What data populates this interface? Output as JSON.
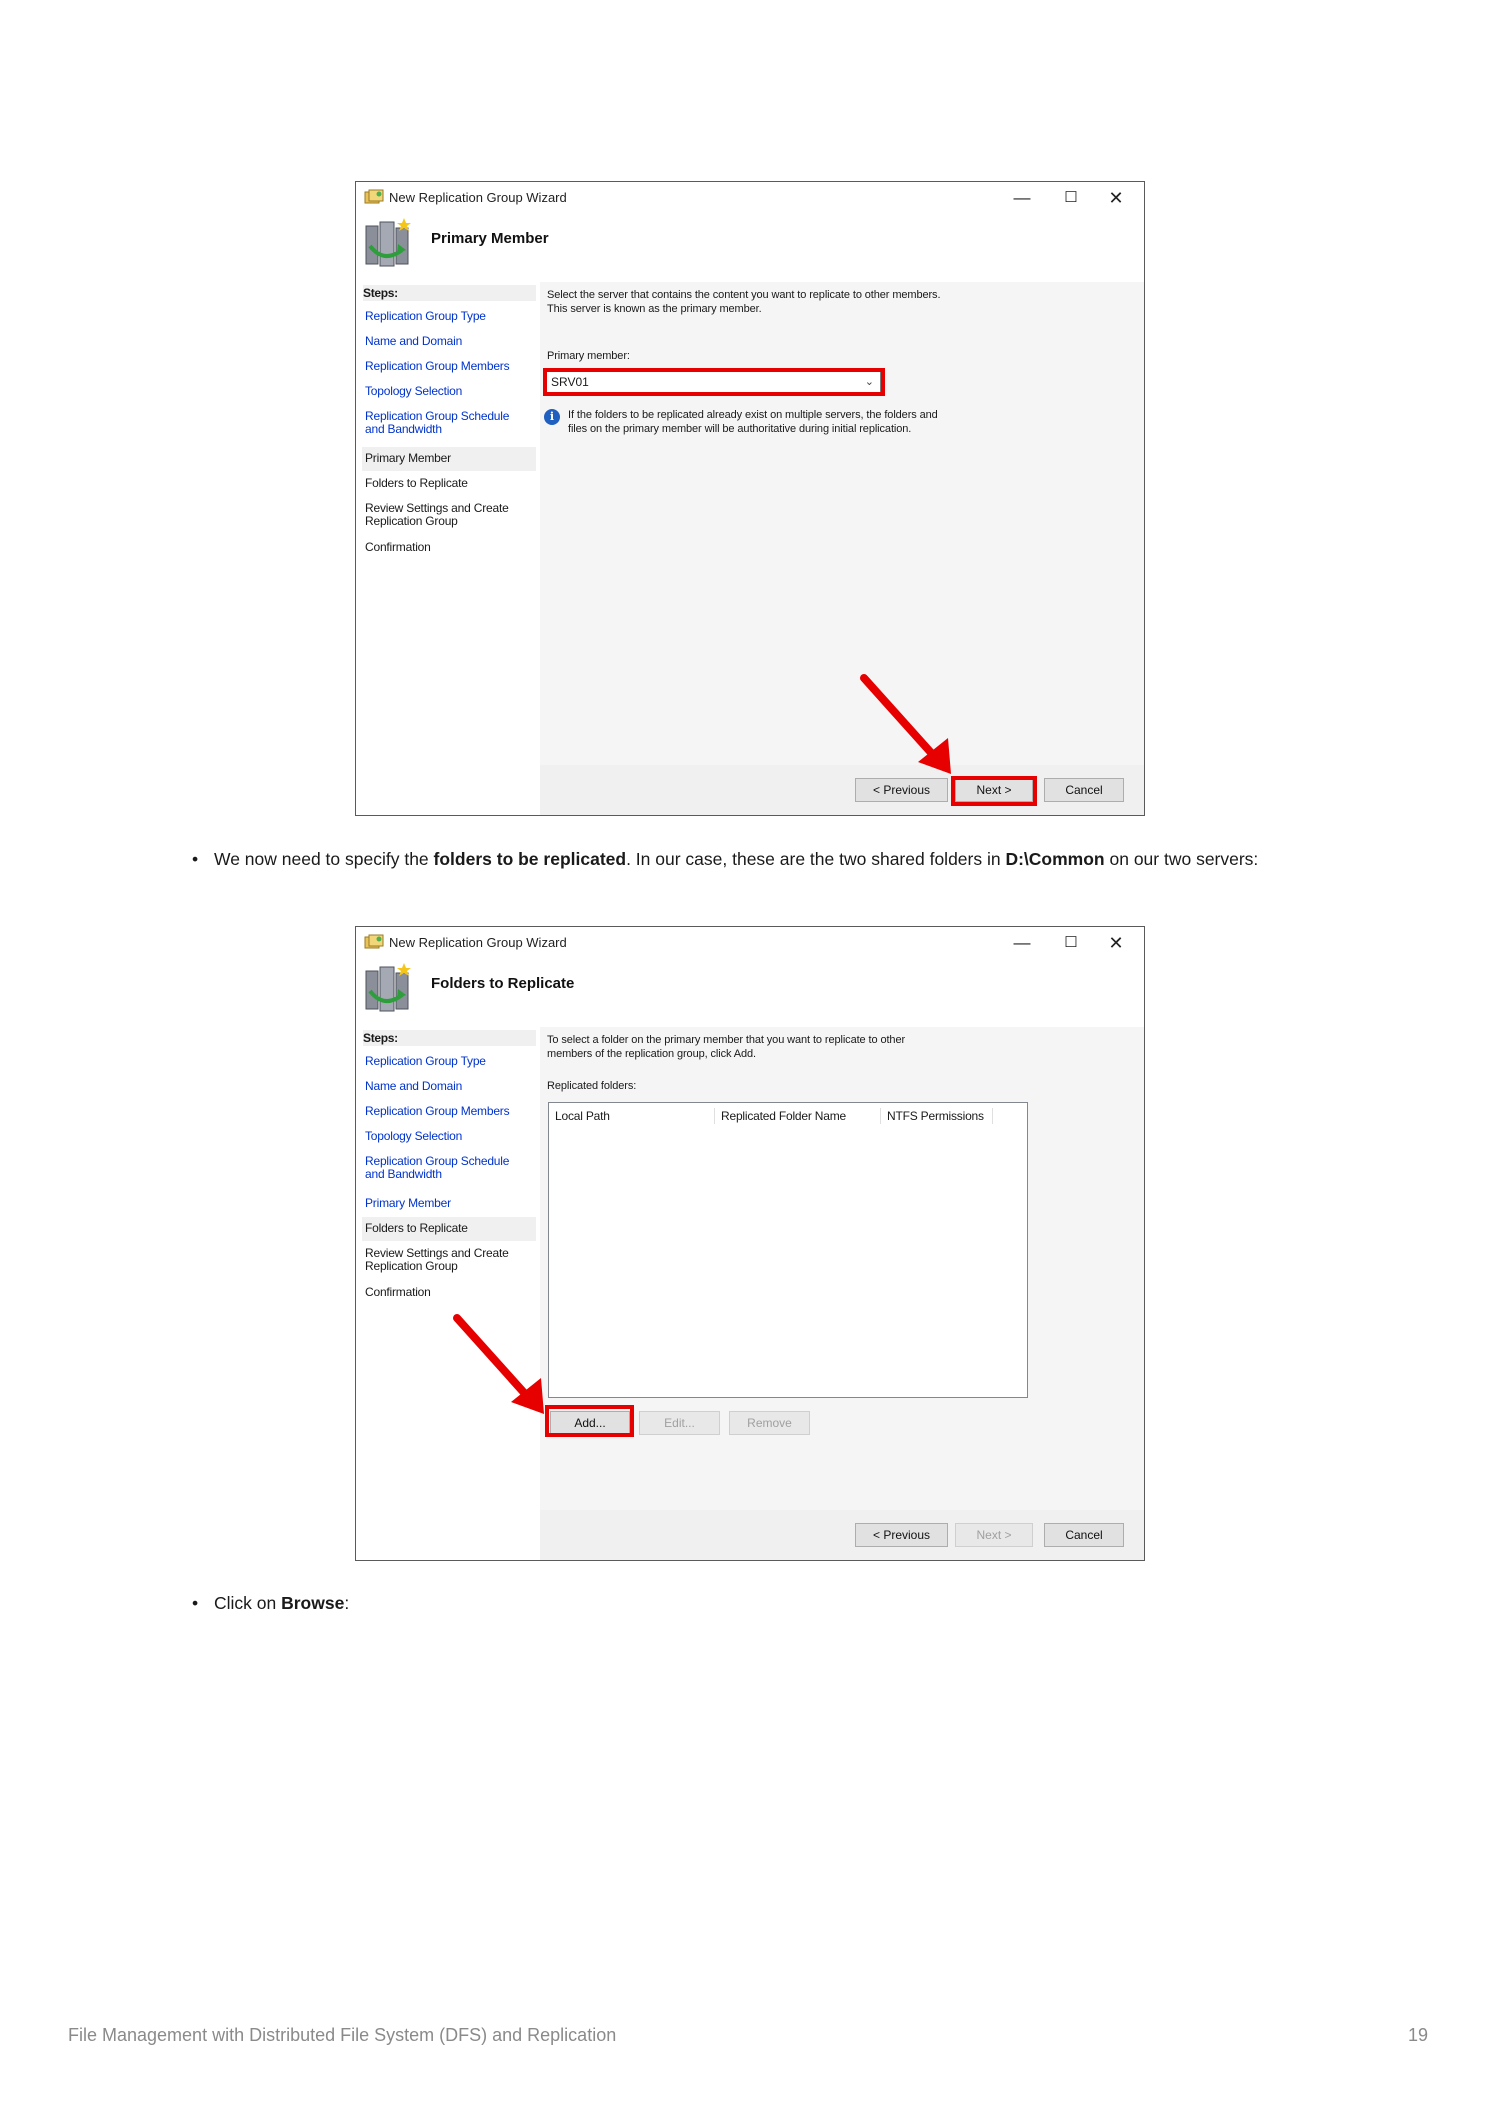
{
  "doc": {
    "bullet1_pre": "We now need to specify the ",
    "bullet1_bold1": "folders to be replicated",
    "bullet1_mid": ". In our case, these are the two shared folders in ",
    "bullet1_bold2": "D:\\Common",
    "bullet1_post": " on our two servers:",
    "bullet2_pre": "Click on ",
    "bullet2_bold": "Browse",
    "bullet2_post": ":",
    "footer_title": "File Management with Distributed File System (DFS) and Replication",
    "page_number": "19"
  },
  "wizard1": {
    "window_title": "New Replication Group Wizard",
    "heading": "Primary Member",
    "steps_label": "Steps:",
    "steps": [
      "Replication Group Type",
      "Name and Domain",
      "Replication Group Members",
      "Topology Selection",
      "Replication Group Schedule and Bandwidth",
      "Primary Member",
      "Folders to Replicate",
      "Review Settings and Create Replication Group",
      "Confirmation"
    ],
    "description_line1": "Select the server that contains the content you want to replicate to other members.",
    "description_line2": "This server is known as the primary member.",
    "primary_member_label": "Primary member:",
    "primary_member_value": "SRV01",
    "info_line1": "If the folders to be replicated already exist on multiple servers, the folders and",
    "info_line2": "files on the primary member will be authoritative during initial replication.",
    "buttons": {
      "previous": "< Previous",
      "next": "Next >",
      "cancel": "Cancel"
    }
  },
  "wizard2": {
    "window_title": "New Replication Group Wizard",
    "heading": "Folders to Replicate",
    "steps_label": "Steps:",
    "steps": [
      "Replication Group Type",
      "Name and Domain",
      "Replication Group Members",
      "Topology Selection",
      "Replication Group Schedule and Bandwidth",
      "Primary Member",
      "Folders to Replicate",
      "Review Settings and Create Replication Group",
      "Confirmation"
    ],
    "description_line1": "To select a folder on the primary member that you want to replicate to other",
    "description_line2": "members of the replication group, click Add.",
    "replicated_folders_label": "Replicated folders:",
    "columns": [
      "Local Path",
      "Replicated Folder Name",
      "NTFS Permissions"
    ],
    "list_buttons": {
      "add": "Add...",
      "edit": "Edit...",
      "remove": "Remove"
    },
    "buttons": {
      "previous": "< Previous",
      "next": "Next >",
      "cancel": "Cancel"
    }
  },
  "icons": {
    "app": "wizard-app-icon",
    "wizard": "replication-server-icon",
    "window_controls": [
      "minimize-icon",
      "maximize-icon",
      "close-icon"
    ],
    "info": "info-icon",
    "dropdown": "chevron-down-icon",
    "annotation": "red-arrow"
  },
  "colors": {
    "link": "#0033cc",
    "highlight": "#e60000",
    "pane": "#f5f5f5"
  }
}
